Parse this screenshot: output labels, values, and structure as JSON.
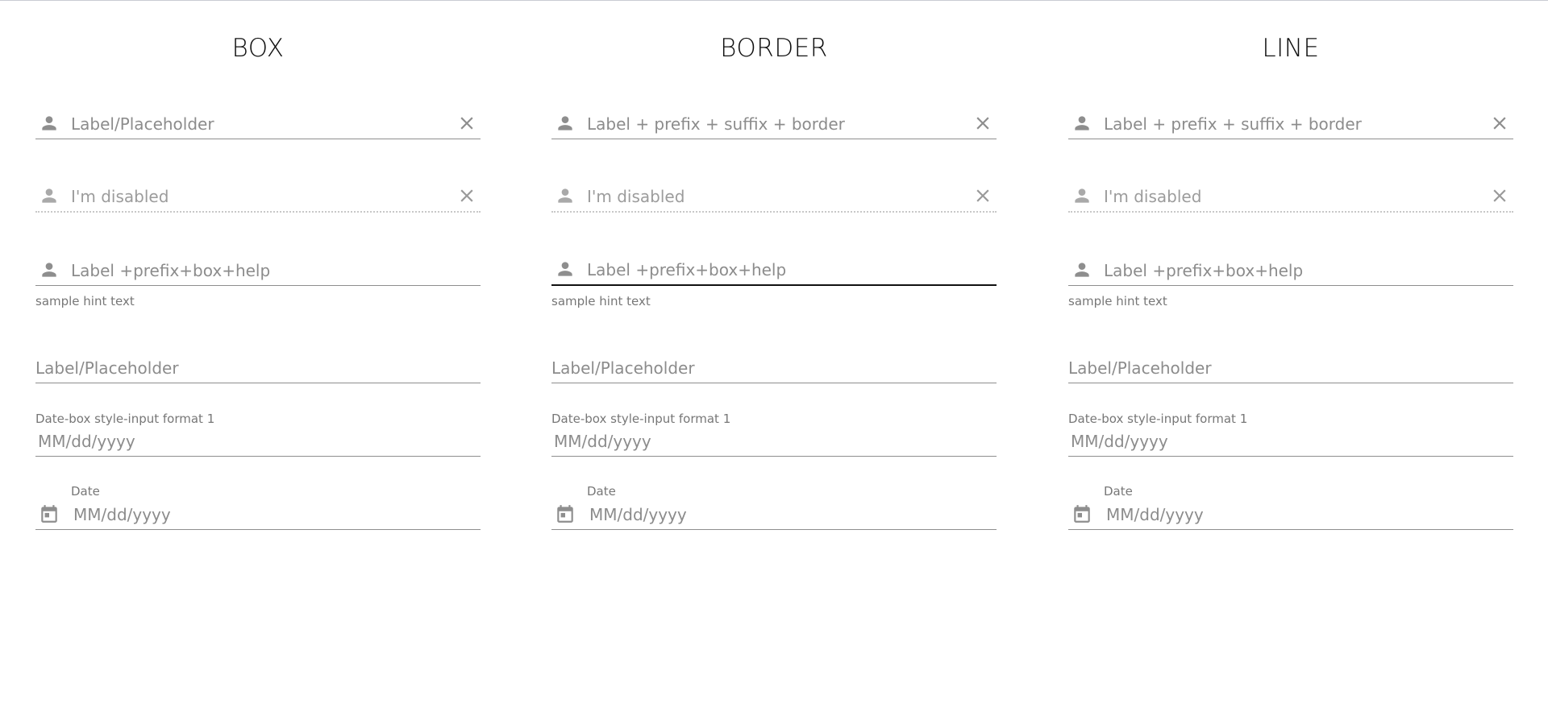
{
  "columns": [
    {
      "title": "BOX",
      "field1": {
        "label": "Label/Placeholder"
      },
      "field2": {
        "label": "I'm disabled"
      },
      "field3": {
        "label": "Label +prefix+box+help",
        "hint": "sample hint text"
      },
      "field4": {
        "label": "Label/Placeholder"
      },
      "field5": {
        "label": "Date-box style-input format 1",
        "placeholder": "MM/dd/yyyy"
      },
      "field6": {
        "label": "Date",
        "placeholder": "MM/dd/yyyy"
      }
    },
    {
      "title": "BORDER",
      "field1": {
        "label": "Label + prefix + suffix + border"
      },
      "field2": {
        "label": "I'm disabled"
      },
      "field3": {
        "label": "Label +prefix+box+help",
        "hint": "sample hint text"
      },
      "field4": {
        "label": "Label/Placeholder"
      },
      "field5": {
        "label": "Date-box style-input format 1",
        "placeholder": "MM/dd/yyyy"
      },
      "field6": {
        "label": "Date",
        "placeholder": "MM/dd/yyyy"
      }
    },
    {
      "title": "LINE",
      "field1": {
        "label": "Label + prefix + suffix + border"
      },
      "field2": {
        "label": "I'm disabled"
      },
      "field3": {
        "label": "Label +prefix+box+help",
        "hint": "sample hint text"
      },
      "field4": {
        "label": "Label/Placeholder"
      },
      "field5": {
        "label": "Date-box style-input format 1",
        "placeholder": "MM/dd/yyyy"
      },
      "field6": {
        "label": "Date",
        "placeholder": "MM/dd/yyyy"
      }
    }
  ],
  "icons": {
    "prefix": "person-icon",
    "suffix": "close-icon",
    "date": "calendar-icon"
  },
  "colors": {
    "title": "#111111",
    "text": "#8c8c8c",
    "underline": "#8e8e8e",
    "focused_underline": "#111111",
    "icon": "#8e8e8e"
  }
}
